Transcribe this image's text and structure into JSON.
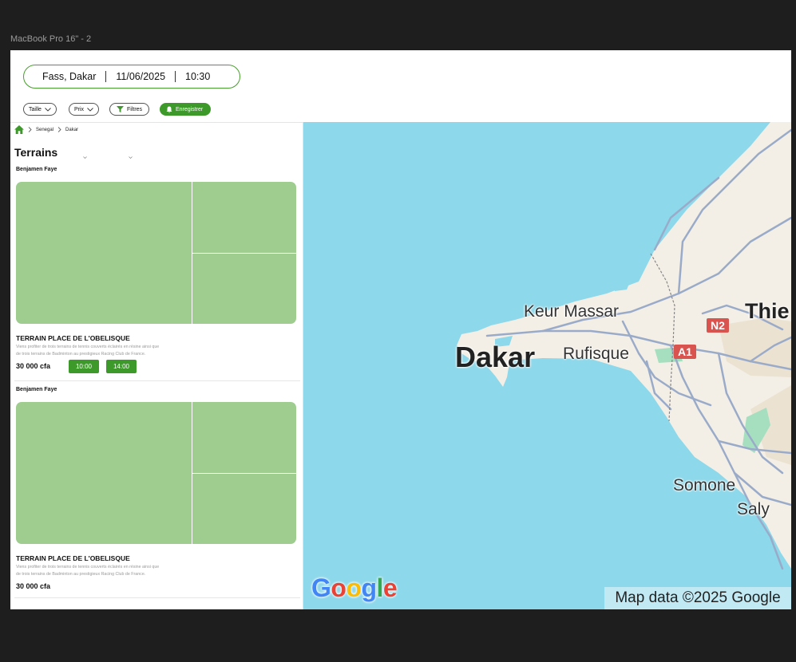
{
  "canvas": {
    "frame_label": "MacBook Pro 16\" - 2"
  },
  "search": {
    "location": "Fass, Dakar",
    "date": "11/06/2025",
    "time": "10:30"
  },
  "filters": {
    "size": "Taille",
    "price": "Prix",
    "filters": "Filtres",
    "save": "Enregistrer"
  },
  "breadcrumb": {
    "country": "Senegal",
    "city": "Dakar"
  },
  "page": {
    "title": "Terrains"
  },
  "cards": [
    {
      "owner": "Benjamen Faye",
      "title": "TERRAIN PLACE DE L'OBELISQUE",
      "desc_line1": "Viens profiter de trois terrains de tennis couverts éclairés en résine  ainsi que",
      "desc_line2": "de trois terrains de Badminton au prestigieux Racing Club de  France.",
      "price": "30 000 cfa",
      "slots": [
        "10:00",
        "14:00"
      ]
    },
    {
      "owner": "Benjamen Faye",
      "title": "TERRAIN PLACE DE L'OBELISQUE",
      "desc_line1": "Viens profiter de trois terrains de tennis couverts éclairés en résine  ainsi que",
      "desc_line2": "de trois terrains de Badminton au prestigieux Racing Club de  France.",
      "price": "30 000 cfa"
    }
  ],
  "map": {
    "places": {
      "keur_massar": "Keur Massar",
      "dakar": "Dakar",
      "rufisque": "Rufisque",
      "thies": "Thie",
      "somone": "Somone",
      "saly": "Saly"
    },
    "roads": {
      "n2": "N2",
      "a1": "A1"
    },
    "attribution": "Map data ©2025 Google",
    "logo": [
      "G",
      "o",
      "o",
      "g",
      "l",
      "e"
    ],
    "colors": {
      "water": "#8dd8ea",
      "land": "#f3efe6",
      "road": "#9aabc9",
      "park": "#a6dfbf",
      "brand_green": "#3d9a2a"
    }
  }
}
